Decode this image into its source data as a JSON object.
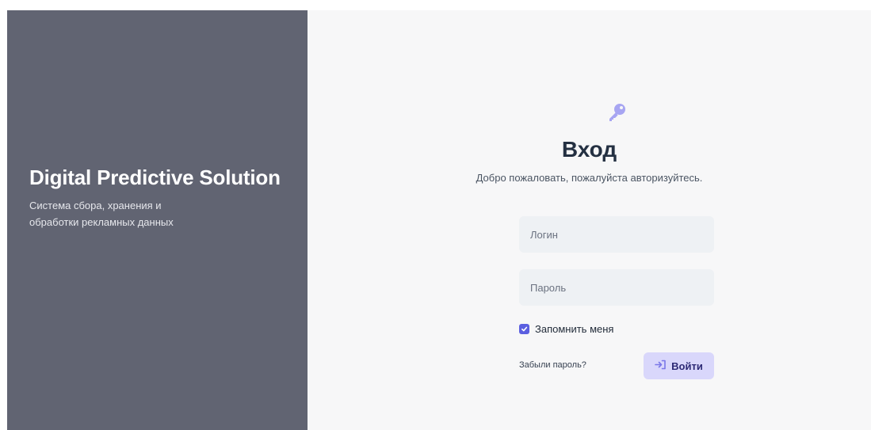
{
  "brand": {
    "title": "Digital Predictive Solution",
    "subtitle": "Система сбора, хранения и обработки рекламных данных"
  },
  "login": {
    "icon": "key-icon",
    "title": "Вход",
    "subtitle": "Добро пожаловать, пожалуйста авторизуйтесь.",
    "username_placeholder": "Логин",
    "username_value": "",
    "password_placeholder": "Пароль",
    "password_value": "",
    "remember_label": "Запомнить меня",
    "remember_checked": true,
    "forgot_label": "Забыли пароль?",
    "submit_label": "Войти",
    "submit_icon": "sign-in-icon"
  },
  "colors": {
    "left_panel": "#616472",
    "right_panel": "#f7f7f8",
    "accent": "#5b5fe0",
    "key_icon": "#a7a5f2",
    "button_bg": "#d9d7fb",
    "input_bg": "#eef1f4"
  }
}
